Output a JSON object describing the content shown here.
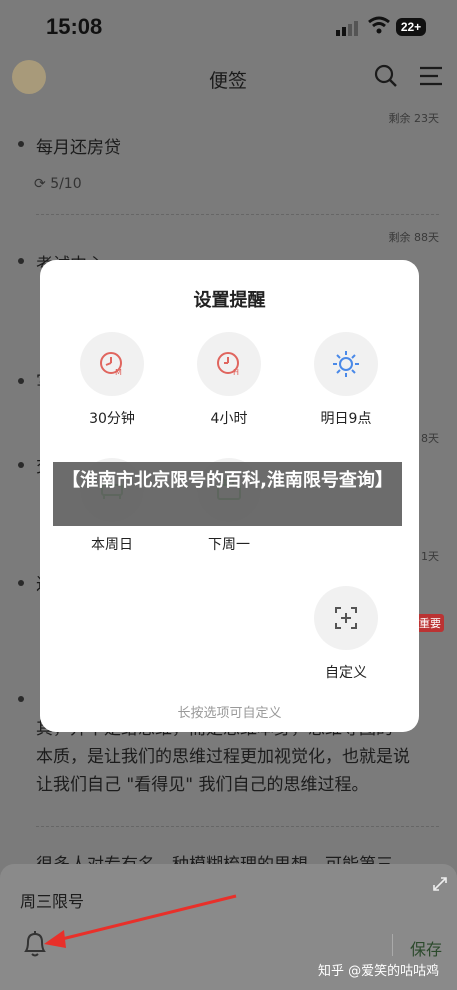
{
  "status_bar": {
    "time": "15:08",
    "battery": "22+"
  },
  "header": {
    "title": "便签"
  },
  "notes": [
    {
      "title": "每月还房贷",
      "sub": "5/10",
      "meta": "剩余 23天"
    },
    {
      "title": "考试中心",
      "meta": "剩余 88天"
    },
    {
      "title": "写"
    },
    {
      "title": "交",
      "meta": "8天"
    },
    {
      "title": "过",
      "meta": "1天",
      "tag": "重要"
    }
  ],
  "article": {
    "line1": "其，并不是给思维，而是思维本身，思维导图的",
    "line2": "本质，是让我们的思维过程更加视觉化，也就是说",
    "line3": "让我们自己 \"看得见\" 我们自己的思维过程。",
    "line4": "很多人对专有名，种模糊梳理的思想，可能第三"
  },
  "dialog": {
    "title": "设置提醒",
    "options": [
      "30分钟",
      "4小时",
      "明日9点",
      "本周日",
      "下周一",
      "自定义"
    ],
    "hint": "长按选项可自定义"
  },
  "banner": {
    "text": "【淮南市北京限号的百科,淮南限号查询】"
  },
  "sheet": {
    "note_text": "周三限号",
    "save_label": "保存"
  },
  "watermark": "知乎 @爱笑的咕咕鸡",
  "colors": {
    "red_icon": "#e0655e",
    "blue_icon": "#4a89e8",
    "green_icon": "#4caf50",
    "annotation_arrow": "#e8302a"
  }
}
